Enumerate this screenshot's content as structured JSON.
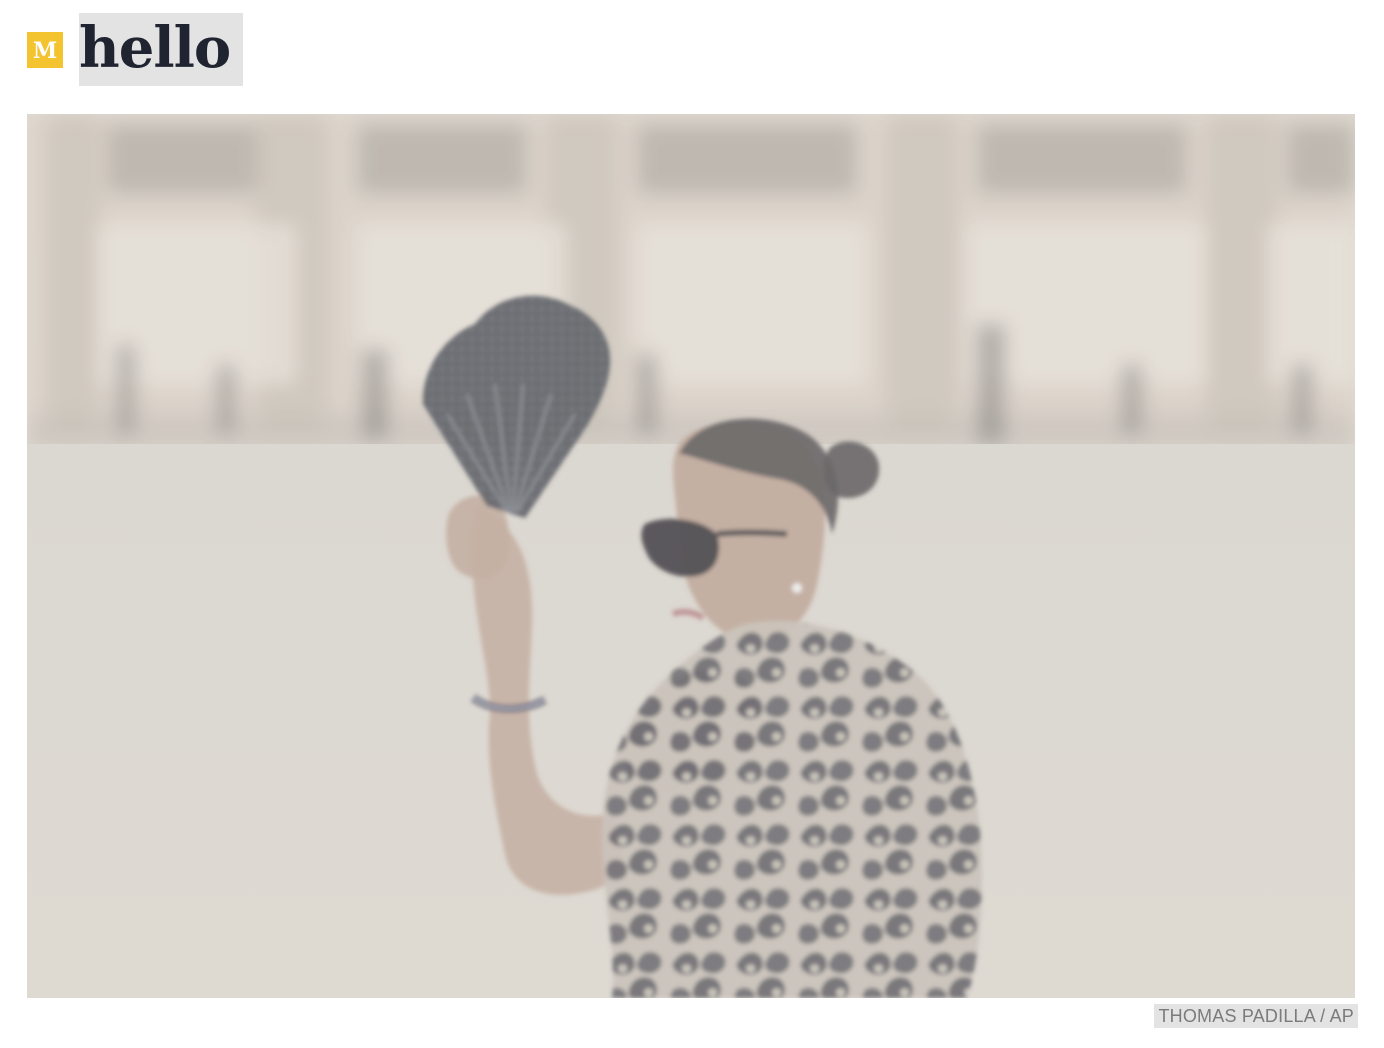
{
  "header": {
    "logo_glyph": "M",
    "title": "hello"
  },
  "media": {
    "image_alt": "Woman in leopard print top and sunglasses fanning herself with a black lace fan",
    "credit": "THOMAS PADILLA / AP"
  }
}
